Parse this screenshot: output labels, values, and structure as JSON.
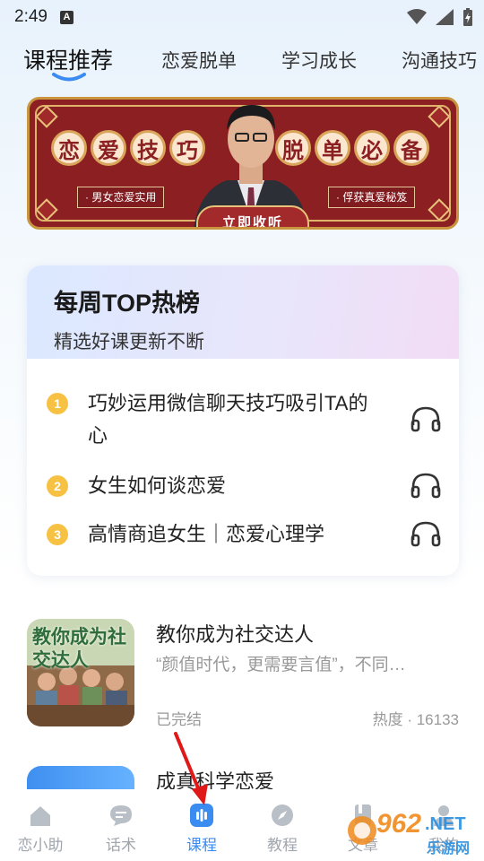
{
  "status": {
    "time": "2:49",
    "indicator": "A"
  },
  "tabs": [
    {
      "label": "课程推荐",
      "active": true
    },
    {
      "label": "恋爱脱单",
      "active": false
    },
    {
      "label": "学习成长",
      "active": false
    },
    {
      "label": "沟通技巧",
      "active": false
    }
  ],
  "banner": {
    "left_chars": [
      "恋",
      "爱",
      "技",
      "巧"
    ],
    "right_chars": [
      "脱",
      "单",
      "必",
      "备"
    ],
    "tag_left": "· 男女恋爱实用",
    "tag_right": "· 俘获真爱秘笈",
    "button": "立即收听"
  },
  "weekly": {
    "title": "每周TOP热榜",
    "subtitle": "精选好课更新不断",
    "items": [
      {
        "rank": "1",
        "title": "巧妙运用微信聊天技巧吸引TA的心"
      },
      {
        "rank": "2",
        "title": "女生如何谈恋爱"
      },
      {
        "rank": "3",
        "title": "高情商追女生｜恋爱心理学"
      }
    ]
  },
  "courses": [
    {
      "title": "教你成为社交达人",
      "cover_text": "教你成为社交达人",
      "description": "“颜值时代，更需要言值”，不同…",
      "status": "已完结",
      "heat": "热度 · 16133"
    },
    {
      "title": "成真科学恋爱"
    }
  ],
  "nav": [
    {
      "label": "恋小助",
      "icon": "home-icon",
      "active": false
    },
    {
      "label": "话术",
      "icon": "chat-icon",
      "active": false
    },
    {
      "label": "课程",
      "icon": "audio-icon",
      "active": true
    },
    {
      "label": "教程",
      "icon": "compass-icon",
      "active": false
    },
    {
      "label": "文章",
      "icon": "book-icon",
      "active": false
    },
    {
      "label": "我的",
      "icon": "user-icon",
      "active": false
    }
  ],
  "watermark": {
    "brand": "962",
    "domain": ".NET",
    "site": "乐游网"
  },
  "colors": {
    "accent": "#3b8cf0",
    "banner_red": "#8b1f22",
    "rank_yellow": "#f7c243"
  }
}
